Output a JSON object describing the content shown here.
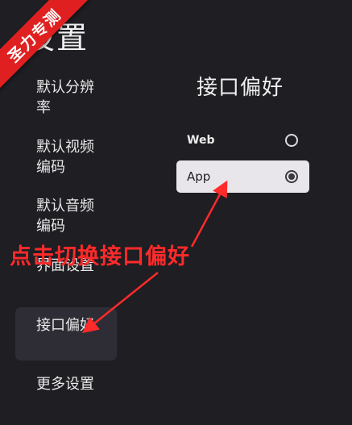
{
  "header": {
    "title": "设置"
  },
  "ribbon": {
    "text": "圣力专测"
  },
  "sidebar": {
    "items": [
      {
        "label": "默认分辨率"
      },
      {
        "label": "默认视频编码"
      },
      {
        "label": "默认音频编码"
      },
      {
        "label": "界面设置"
      },
      {
        "label": "接口偏好"
      },
      {
        "label": "更多设置"
      }
    ],
    "selected_index": 4
  },
  "panel": {
    "title": "接口偏好",
    "options": [
      {
        "label": "Web",
        "selected": false
      },
      {
        "label": "App",
        "selected": true
      }
    ]
  },
  "annotation": {
    "text": "点击切换接口偏好",
    "color": "#ff2a2a"
  },
  "colors": {
    "background": "#1e1e23",
    "selected_item": "#2e2d35",
    "ribbon": "#e02020"
  }
}
